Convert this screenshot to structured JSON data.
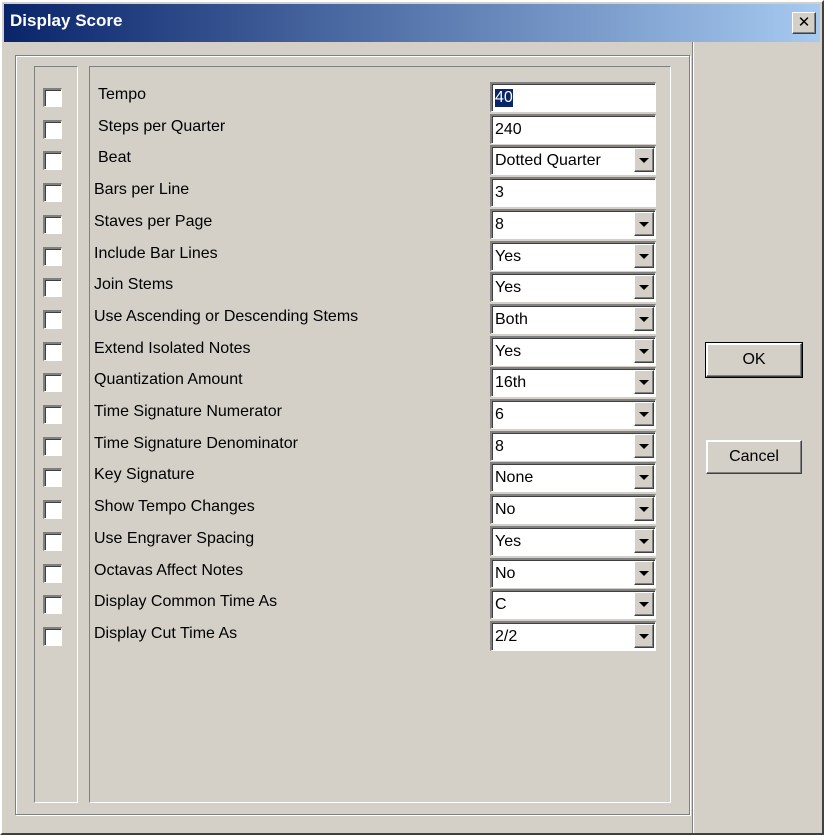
{
  "window": {
    "title": "Display Score",
    "close_glyph": "✕"
  },
  "buttons": {
    "ok": "OK",
    "cancel": "Cancel"
  },
  "rows": [
    {
      "label": "Tempo",
      "kind": "text",
      "value": "40",
      "selected": true,
      "checked": false
    },
    {
      "label": "Steps per Quarter",
      "kind": "text",
      "value": "240",
      "checked": false
    },
    {
      "label": "Beat",
      "kind": "select",
      "value": "Dotted Quarter",
      "checked": false
    },
    {
      "label": "Bars per Line",
      "kind": "text",
      "value": "3",
      "checked": false
    },
    {
      "label": "Staves per Page",
      "kind": "select",
      "value": "8",
      "checked": false
    },
    {
      "label": "Include Bar Lines",
      "kind": "select",
      "value": "Yes",
      "checked": false
    },
    {
      "label": "Join Stems",
      "kind": "select",
      "value": "Yes",
      "checked": false
    },
    {
      "label": "Use Ascending or Descending Stems",
      "kind": "select",
      "value": "Both",
      "checked": false
    },
    {
      "label": "Extend Isolated Notes",
      "kind": "select",
      "value": "Yes",
      "checked": false
    },
    {
      "label": "Quantization Amount",
      "kind": "select",
      "value": "16th",
      "checked": false
    },
    {
      "label": "Time Signature Numerator",
      "kind": "select",
      "value": "6",
      "checked": false
    },
    {
      "label": "Time Signature Denominator",
      "kind": "select",
      "value": "8",
      "checked": false
    },
    {
      "label": "Key Signature",
      "kind": "select",
      "value": "None",
      "checked": false
    },
    {
      "label": "Show Tempo Changes",
      "kind": "select",
      "value": "No",
      "checked": false
    },
    {
      "label": "Use Engraver Spacing",
      "kind": "select",
      "value": "Yes",
      "checked": false
    },
    {
      "label": "Octavas Affect Notes",
      "kind": "select",
      "value": "No",
      "checked": false
    },
    {
      "label": "Display Common Time As",
      "kind": "select",
      "value": "C",
      "checked": false
    },
    {
      "label": "Display Cut Time As",
      "kind": "select",
      "value": "2/2",
      "checked": false
    }
  ]
}
